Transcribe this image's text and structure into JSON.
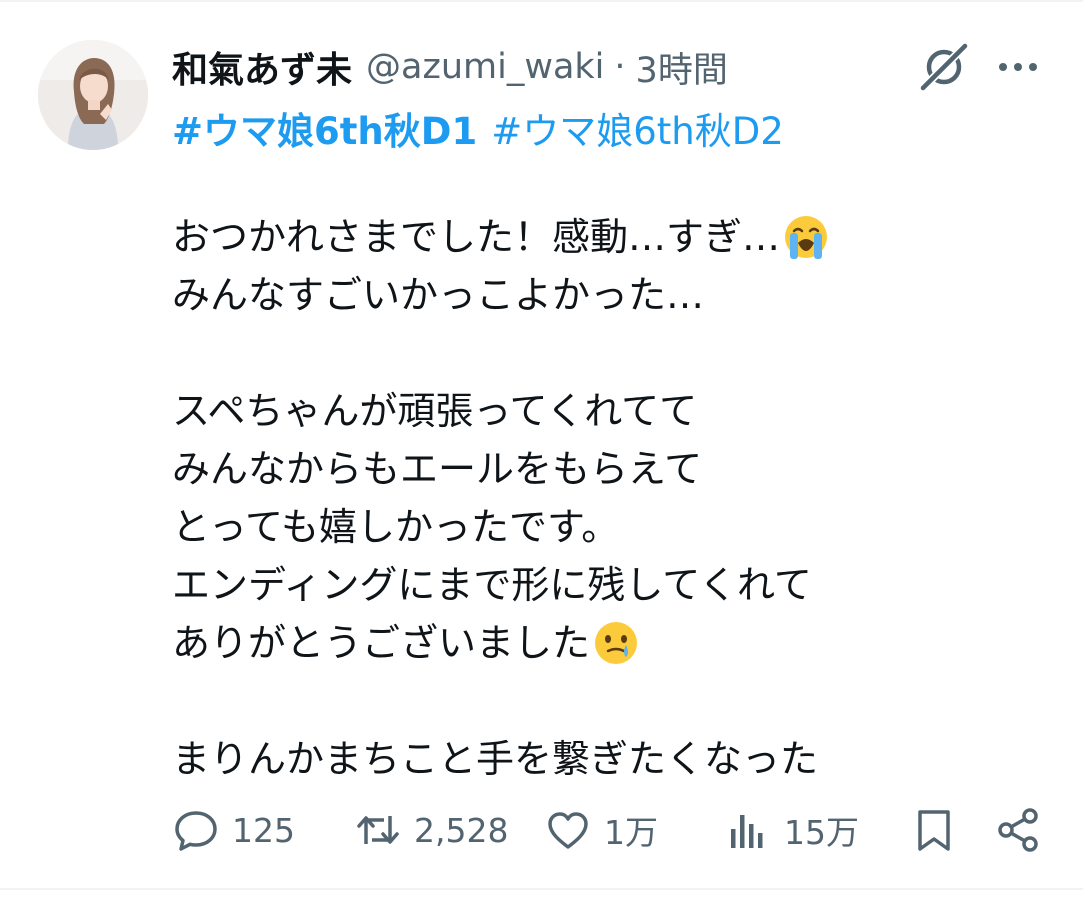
{
  "post": {
    "author": {
      "display_name": "和氣あず未",
      "handle": "@azumi_waki",
      "separator": "·",
      "time": "3時間"
    },
    "hashtags": [
      {
        "text": "#ウマ娘6th秋D1",
        "style": "bold"
      },
      {
        "text": "#ウマ娘6th秋D2",
        "style": "regular"
      }
    ],
    "body": {
      "line1": "おつかれさまでした！感動…すぎ…",
      "line1_emoji": "loudly-crying-face",
      "line2": "みんなすごいかっこよかった…",
      "line3": "スペちゃんが頑張ってくれてて",
      "line4": "みんなからもエールをもらえて",
      "line5": "とっても嬉しかったです。",
      "line6": "エンディングにまで形に残してくれて",
      "line7": "ありがとうございました",
      "line7_emoji": "face-holding-back-tears",
      "line8": "まりんかまちこと手を繋ぎたくなった"
    },
    "actions": {
      "replies": "125",
      "reposts": "2,528",
      "likes": "1万",
      "views": "15万"
    }
  },
  "colors": {
    "link": "#1d9bf0",
    "text": "#0f1419",
    "muted": "#536471",
    "divider": "#eff3f4"
  },
  "icons": [
    "avatar",
    "grok-icon",
    "more-icon",
    "reply-icon",
    "retweet-icon",
    "like-icon",
    "views-icon",
    "bookmark-icon",
    "share-icon"
  ]
}
